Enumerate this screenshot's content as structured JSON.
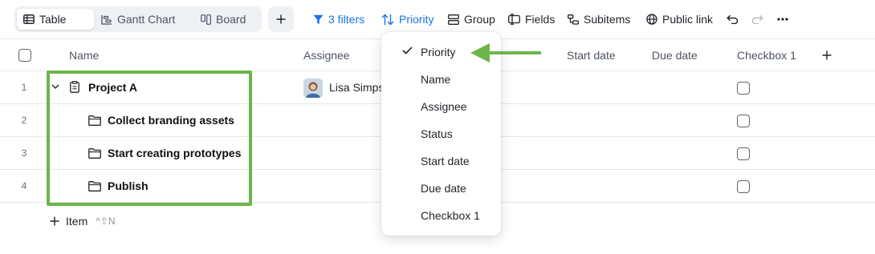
{
  "toolbar": {
    "views": [
      {
        "label": "Table",
        "icon": "table-icon",
        "active": true
      },
      {
        "label": "Gantt Chart",
        "icon": "gantt-icon",
        "active": false
      },
      {
        "label": "Board",
        "icon": "board-icon",
        "active": false
      }
    ],
    "filters_label": "3 filters",
    "sort_label": "Priority",
    "group_label": "Group",
    "fields_label": "Fields",
    "subitems_label": "Subitems",
    "public_link_label": "Public link",
    "accent_color": "#1a73e8"
  },
  "table": {
    "columns": [
      "Name",
      "Assignee",
      "Start date",
      "Due date",
      "Checkbox 1"
    ],
    "rows": [
      {
        "num": "1",
        "name": "Project A",
        "assignee": "Lisa Simps",
        "checked": false
      },
      {
        "num": "2",
        "name": "Collect branding assets",
        "assignee": "",
        "checked": false
      },
      {
        "num": "3",
        "name": "Start creating prototypes",
        "assignee": "",
        "checked": false
      },
      {
        "num": "4",
        "name": "Publish",
        "assignee": "",
        "checked": false
      }
    ],
    "add_item_label": "Item",
    "add_item_shortcut": "^⇧N"
  },
  "sort_dropdown": {
    "items": [
      "Priority",
      "Name",
      "Assignee",
      "Status",
      "Start date",
      "Due date",
      "Checkbox 1"
    ],
    "selected": "Priority"
  },
  "annotation_color": "#6cb54b"
}
